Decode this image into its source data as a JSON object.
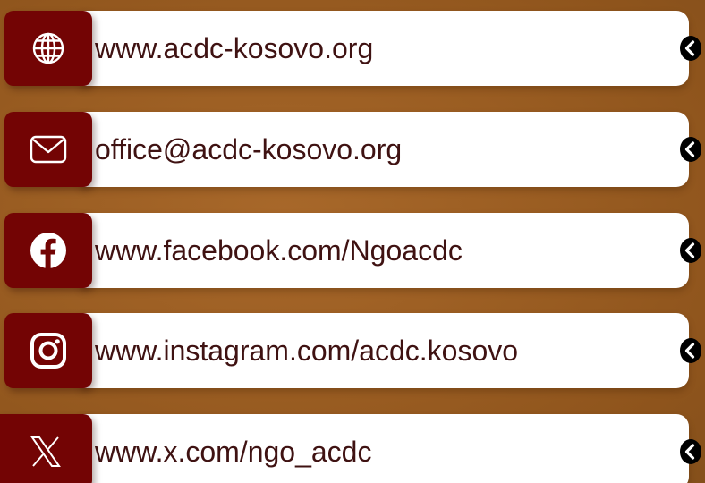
{
  "links": [
    {
      "icon": "globe-icon",
      "text": "www.acdc-kosovo.org"
    },
    {
      "icon": "mail-icon",
      "text": "office@acdc-kosovo.org"
    },
    {
      "icon": "facebook-icon",
      "text": "www.facebook.com/Ngoacdc"
    },
    {
      "icon": "instagram-icon",
      "text": "www.instagram.com/acdc.kosovo"
    },
    {
      "icon": "x-logo-icon",
      "text": "www.x.com/ngo_acdc"
    }
  ],
  "colors": {
    "background": "#9a5d22",
    "icon_box": "#730404",
    "card": "#ffffff",
    "text": "#3f1212",
    "chevron": "#000000"
  }
}
